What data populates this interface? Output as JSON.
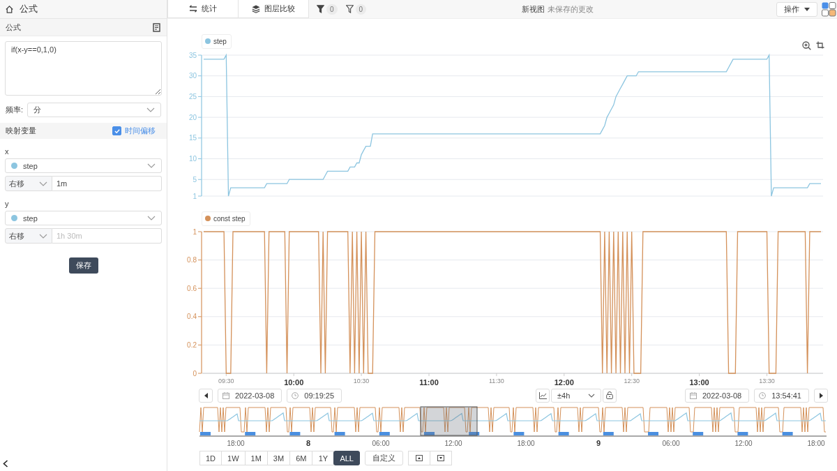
{
  "sidebar": {
    "title": "公式",
    "formula_section": "公式",
    "formula": "if(x-y==0,1,0)",
    "frequency": {
      "label": "频率:",
      "value": "分"
    },
    "mapping": {
      "title": "映射变量",
      "time_offset": {
        "label": "时间偏移",
        "checked": true
      }
    },
    "variables": [
      {
        "name": "x",
        "series": "step",
        "shift": {
          "direction": "右移",
          "value": "1m"
        }
      },
      {
        "name": "y",
        "series": "step",
        "shift": {
          "direction": "右移",
          "placeholder": "1h 30m"
        }
      }
    ],
    "save_button": "保存"
  },
  "toolbar": {
    "buttons": [
      {
        "label": "统计",
        "kind": "stats"
      },
      {
        "label": "图层比较",
        "kind": "layers"
      }
    ],
    "filters": [
      {
        "count": "0",
        "kind": "filled"
      },
      {
        "count": "0",
        "kind": "outline"
      }
    ],
    "view_name": "新视图",
    "view_status": "未保存的更改",
    "action_menu": "操作"
  },
  "charts": [
    {
      "chart_data": {
        "type": "line",
        "categories": [
          null,
          null,
          null,
          null,
          null,
          null,
          null,
          null,
          null,
          null,
          null,
          null,
          null,
          null,
          null,
          null,
          null,
          null,
          null,
          null,
          null,
          null,
          null,
          null,
          null,
          null,
          null,
          null,
          null,
          null,
          null,
          null,
          null,
          null,
          null,
          null,
          null,
          null,
          null,
          null,
          null,
          null,
          null,
          null,
          null,
          null,
          null,
          null,
          null,
          null,
          null,
          null,
          null,
          null,
          null,
          null,
          null,
          null,
          null,
          null,
          null,
          null,
          null,
          null,
          null,
          null,
          null,
          null,
          null,
          null,
          null,
          null,
          null,
          null,
          null,
          null,
          null,
          null,
          null,
          null,
          null,
          null,
          null,
          null,
          null,
          null,
          null,
          null,
          null,
          null,
          null,
          null,
          null,
          null,
          null,
          null,
          null,
          null,
          null,
          null,
          null,
          null,
          null,
          null,
          null,
          null,
          null,
          null,
          null,
          null,
          null,
          null,
          null,
          null,
          null,
          null,
          null,
          null,
          null,
          null,
          null,
          null,
          null,
          null,
          null,
          null,
          null,
          null,
          null,
          null,
          null,
          null,
          null,
          null,
          null,
          null,
          null,
          null,
          null,
          null,
          null,
          null,
          null,
          null,
          null,
          null,
          null,
          null,
          null,
          null,
          null,
          null,
          null,
          null,
          null,
          null,
          null,
          null,
          null,
          null,
          null,
          null,
          null,
          null,
          null,
          null,
          null,
          null,
          null,
          null,
          null,
          null,
          null,
          null,
          null,
          null,
          null,
          null,
          null,
          null,
          null,
          null,
          null,
          null,
          null,
          null,
          null,
          null,
          null,
          null,
          null,
          null,
          null,
          null,
          null,
          null,
          null,
          null,
          null,
          null,
          null,
          null,
          null,
          null,
          null,
          null,
          null,
          null,
          null,
          null,
          null,
          null,
          null,
          null,
          null,
          null,
          null,
          null,
          null,
          null,
          null,
          null,
          null,
          null,
          null,
          null,
          null,
          null,
          null,
          null,
          null,
          null,
          null,
          null,
          null,
          null,
          null,
          null,
          null,
          null,
          null,
          null,
          null,
          null,
          null,
          null,
          null,
          null,
          null,
          null,
          null,
          null,
          null,
          null,
          null,
          null,
          null,
          null,
          null,
          null,
          null,
          null,
          null,
          null,
          null,
          null,
          null,
          null,
          null,
          null,
          null,
          null,
          null,
          null,
          null
        ],
        "series": [
          {
            "name": "step",
            "color": "#8cc5e0",
            "values": [
              34,
              34,
              34,
              34,
              34,
              34,
              34,
              34,
              34,
              34,
              35,
              1,
              3,
              3,
              3,
              3,
              3,
              3,
              3,
              3,
              3,
              3,
              3,
              3,
              3,
              3,
              3,
              3,
              4,
              4,
              4,
              4,
              4,
              4,
              4,
              4,
              4,
              4,
              5,
              5,
              5,
              5,
              5,
              5,
              5,
              5,
              5,
              5,
              5,
              5,
              5,
              5,
              5,
              5,
              6,
              7,
              7,
              7,
              7,
              7,
              7,
              7,
              7,
              7,
              7,
              8,
              8,
              8,
              9,
              9,
              11,
              12,
              13,
              13,
              13,
              16,
              16,
              16,
              16,
              16,
              16,
              16,
              16,
              16,
              16,
              16,
              16,
              16,
              16,
              16,
              16,
              16,
              16,
              16,
              16,
              16,
              16,
              16,
              16,
              16,
              16,
              16,
              16,
              16,
              16,
              16,
              16,
              16,
              16,
              16,
              16,
              16,
              16,
              16,
              16,
              16,
              16,
              16,
              16,
              16,
              16,
              16,
              16,
              16,
              16,
              16,
              16,
              16,
              16,
              16,
              16,
              16,
              16,
              16,
              16,
              16,
              16,
              16,
              16,
              16,
              16,
              16,
              16,
              16,
              16,
              16,
              16,
              16,
              16,
              16,
              16,
              16,
              16,
              16,
              16,
              16,
              16,
              16,
              16,
              16,
              16,
              16,
              16,
              16,
              16,
              16,
              16,
              16,
              16,
              16,
              16,
              16,
              16,
              16,
              16,
              16,
              16,
              17,
              18,
              20,
              21,
              22,
              23,
              25,
              26,
              27,
              28,
              29,
              30,
              30,
              30,
              30,
              30,
              31,
              31,
              31,
              31,
              31,
              31,
              31,
              31,
              31,
              31,
              31,
              31,
              31,
              31,
              31,
              31,
              31,
              31,
              31,
              31,
              31,
              31,
              31,
              31,
              31,
              31,
              31,
              31,
              31,
              31,
              31,
              31,
              31,
              31,
              31,
              31,
              31,
              31,
              31,
              31,
              32,
              33,
              34,
              34,
              34,
              34,
              34,
              34,
              34,
              34,
              34,
              34,
              34,
              34,
              34,
              34,
              34,
              34,
              35,
              1,
              3,
              3,
              3,
              3,
              3,
              3,
              3,
              3,
              3,
              3,
              3,
              3,
              3,
              3,
              3,
              3,
              4,
              4,
              4,
              4,
              4,
              4
            ]
          }
        ],
        "grid": true,
        "ylim": [
          1,
          35
        ],
        "yticks": [
          1,
          5,
          10,
          15,
          20,
          25,
          30,
          35
        ]
      }
    },
    {
      "chart_data": {
        "type": "line",
        "categories": [
          null,
          null,
          null,
          null,
          null,
          null,
          null,
          null,
          null,
          null,
          "09:30",
          null,
          null,
          null,
          null,
          null,
          null,
          null,
          null,
          null,
          null,
          null,
          null,
          null,
          null,
          null,
          null,
          null,
          null,
          null,
          null,
          null,
          null,
          null,
          null,
          null,
          null,
          null,
          null,
          null,
          "10:00",
          null,
          null,
          null,
          null,
          null,
          null,
          null,
          null,
          null,
          null,
          null,
          null,
          null,
          null,
          null,
          null,
          null,
          null,
          null,
          null,
          null,
          null,
          null,
          null,
          null,
          null,
          null,
          null,
          null,
          "10:30",
          null,
          null,
          null,
          null,
          null,
          null,
          null,
          null,
          null,
          null,
          null,
          null,
          null,
          null,
          null,
          null,
          null,
          null,
          null,
          null,
          null,
          null,
          null,
          null,
          null,
          null,
          null,
          null,
          null,
          "11:00",
          null,
          null,
          null,
          null,
          null,
          null,
          null,
          null,
          null,
          null,
          null,
          null,
          null,
          null,
          null,
          null,
          null,
          null,
          null,
          null,
          null,
          null,
          null,
          null,
          null,
          null,
          null,
          null,
          null,
          "11:30",
          null,
          null,
          null,
          null,
          null,
          null,
          null,
          null,
          null,
          null,
          null,
          null,
          null,
          null,
          null,
          null,
          null,
          null,
          null,
          null,
          null,
          null,
          null,
          null,
          null,
          null,
          null,
          null,
          null,
          "12:00",
          null,
          null,
          null,
          null,
          null,
          null,
          null,
          null,
          null,
          null,
          null,
          null,
          null,
          null,
          null,
          null,
          null,
          null,
          null,
          null,
          null,
          null,
          null,
          null,
          null,
          null,
          null,
          null,
          null,
          "12:30",
          null,
          null,
          null,
          null,
          null,
          null,
          null,
          null,
          null,
          null,
          null,
          null,
          null,
          null,
          null,
          null,
          null,
          null,
          null,
          null,
          null,
          null,
          null,
          null,
          null,
          null,
          null,
          null,
          null,
          "13:00",
          null,
          null,
          null,
          null,
          null,
          null,
          null,
          null,
          null,
          null,
          null,
          null,
          null,
          null,
          null,
          null,
          null,
          null,
          null,
          null,
          null,
          null,
          null,
          null,
          null,
          null,
          null,
          null,
          null,
          "13:30",
          null,
          null,
          null,
          null,
          null,
          null,
          null,
          null,
          null,
          null,
          null,
          null,
          null,
          null,
          null,
          null,
          null,
          null,
          null,
          null,
          null,
          null,
          null,
          null
        ],
        "series": [
          {
            "name": "const step",
            "color": "#d4915a",
            "values": [
              1,
              1,
              1,
              1,
              1,
              1,
              1,
              1,
              1,
              1,
              0,
              0,
              0,
              1,
              1,
              1,
              1,
              1,
              1,
              1,
              1,
              1,
              1,
              1,
              1,
              1,
              1,
              1,
              0,
              1,
              1,
              1,
              1,
              1,
              1,
              1,
              1,
              0,
              1,
              1,
              1,
              1,
              1,
              1,
              1,
              1,
              1,
              1,
              1,
              1,
              1,
              1,
              0,
              1,
              0,
              1,
              1,
              1,
              1,
              1,
              1,
              1,
              1,
              1,
              1,
              0,
              1,
              0,
              1,
              0,
              1,
              0,
              1,
              0,
              0,
              0,
              1,
              1,
              1,
              1,
              1,
              1,
              1,
              1,
              1,
              1,
              1,
              1,
              1,
              1,
              1,
              1,
              1,
              1,
              1,
              1,
              1,
              1,
              1,
              1,
              1,
              1,
              1,
              1,
              1,
              1,
              1,
              1,
              1,
              1,
              1,
              1,
              1,
              1,
              1,
              1,
              1,
              1,
              1,
              1,
              1,
              1,
              1,
              1,
              1,
              1,
              1,
              1,
              1,
              1,
              1,
              1,
              1,
              1,
              1,
              1,
              1,
              1,
              1,
              1,
              1,
              1,
              1,
              1,
              1,
              1,
              1,
              1,
              1,
              1,
              1,
              1,
              1,
              1,
              1,
              1,
              1,
              1,
              1,
              1,
              1,
              1,
              1,
              1,
              1,
              1,
              1,
              1,
              1,
              1,
              1,
              1,
              1,
              1,
              1,
              1,
              1,
              0,
              1,
              0,
              1,
              0,
              1,
              0,
              1,
              0,
              1,
              0,
              1,
              0,
              1,
              0,
              0,
              0,
              0,
              1,
              1,
              1,
              1,
              1,
              1,
              1,
              1,
              1,
              1,
              1,
              1,
              1,
              1,
              1,
              1,
              1,
              1,
              1,
              1,
              1,
              1,
              1,
              1,
              1,
              1,
              1,
              1,
              1,
              1,
              1,
              1,
              1,
              1,
              1,
              1,
              1,
              1,
              0,
              0,
              0,
              0,
              1,
              1,
              1,
              1,
              1,
              1,
              1,
              1,
              1,
              1,
              1,
              1,
              1,
              1,
              0,
              0,
              0,
              0,
              1,
              1,
              1,
              1,
              1,
              1,
              1,
              1,
              1,
              1,
              1,
              1,
              1,
              0,
              1,
              1,
              1,
              1,
              1,
              1
            ]
          }
        ],
        "grid": true,
        "ylim": [
          0,
          1
        ],
        "yticks": [
          0,
          0.2,
          0.4,
          0.6,
          0.8,
          1
        ]
      }
    }
  ],
  "time_controls": {
    "start_date": "2022-03-08",
    "start_time": "09:19:25",
    "window": "±4h",
    "end_date": "2022-03-08",
    "end_time": "13:54:41"
  },
  "navigator": {
    "axis_labels": [
      {
        "label": "18:00",
        "kind": "time"
      },
      {
        "label": "8",
        "kind": "date"
      },
      {
        "label": "06:00",
        "kind": "time"
      },
      {
        "label": "12:00",
        "kind": "time"
      },
      {
        "label": "18:00",
        "kind": "time"
      },
      {
        "label": "9",
        "kind": "date"
      },
      {
        "label": "06:00",
        "kind": "time"
      },
      {
        "label": "12:00",
        "kind": "time"
      },
      {
        "label": "18:00",
        "kind": "time"
      }
    ]
  },
  "ranges": [
    {
      "label": "1D",
      "selected": false
    },
    {
      "label": "1W",
      "selected": false
    },
    {
      "label": "1M",
      "selected": false
    },
    {
      "label": "3M",
      "selected": false
    },
    {
      "label": "6M",
      "selected": false
    },
    {
      "label": "1Y",
      "selected": false
    },
    {
      "label": "ALL",
      "selected": true
    }
  ],
  "custom_range": "自定义"
}
